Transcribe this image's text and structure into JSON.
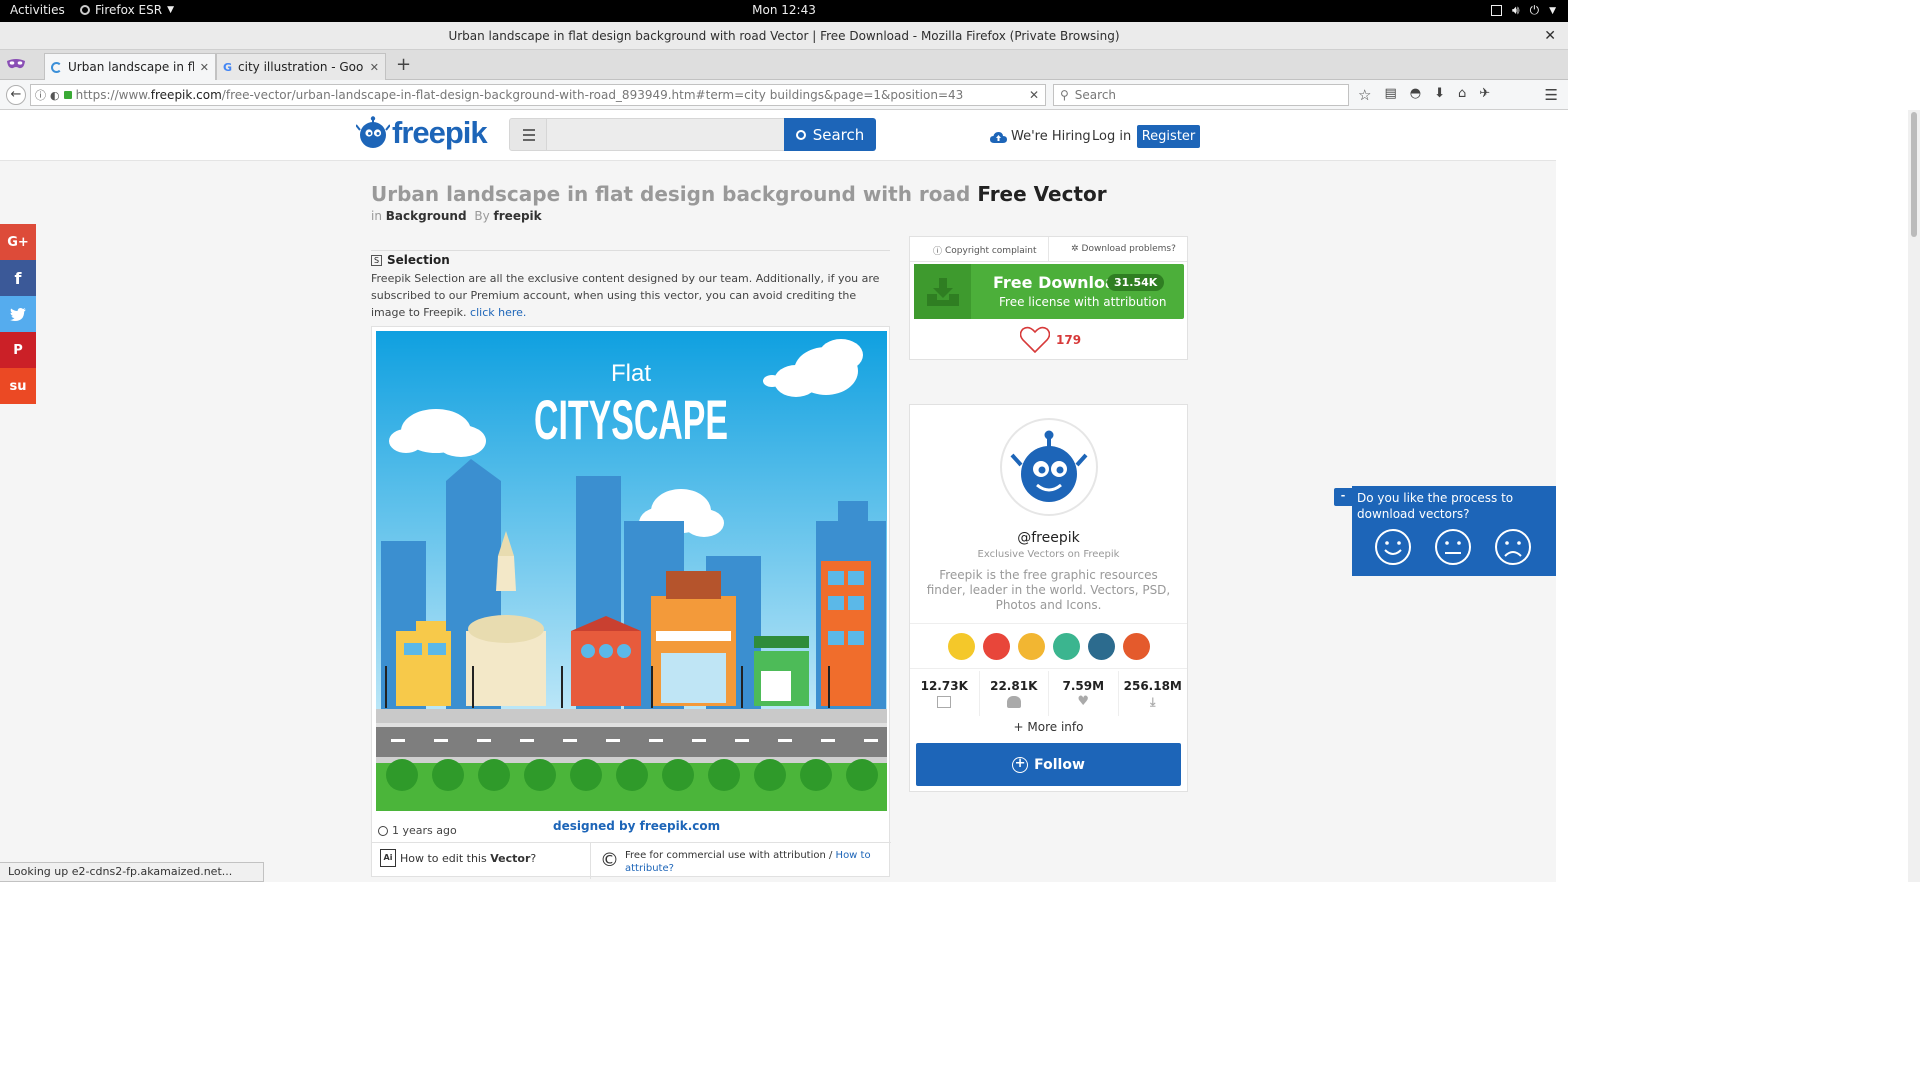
{
  "system_bar": {
    "activities": "Activities",
    "app_menu": "Firefox ESR",
    "clock": "Mon 12:43"
  },
  "window": {
    "title": "Urban landscape in flat design background with road Vector | Free Download - Mozilla Firefox (Private Browsing)",
    "close": "✕"
  },
  "tabs": [
    {
      "label": "Urban landscape in fla...",
      "active": true
    },
    {
      "label": "city illustration - Goog...",
      "active": false
    }
  ],
  "nav": {
    "url_prefix": "https://www.",
    "url_domain": "freepik.com",
    "url_rest": "/free-vector/urban-landscape-in-flat-design-background-with-road_893949.htm#term=city buildings&page=1&position=43",
    "search_placeholder": "Search"
  },
  "site": {
    "logo_text": "freepik",
    "search_button": "Search",
    "hiring": "We're Hiring",
    "login": "Log in",
    "register": "Register"
  },
  "social": [
    {
      "label": "G+",
      "color": "#dd4b39"
    },
    {
      "label": "f",
      "color": "#3b5998"
    },
    {
      "label": "t",
      "color": "#55acee"
    },
    {
      "label": "P",
      "color": "#cb2027"
    },
    {
      "label": "su",
      "color": "#eb4924"
    }
  ],
  "resource": {
    "title": "Urban landscape in flat design background with road",
    "title_suffix": "Free Vector",
    "in_label": "in",
    "category": "Background",
    "by_label": "By",
    "author": "freepik",
    "selection_heading": "Selection",
    "selection_text": "Freepik Selection are all the exclusive content designed by our team. Additionally, if you are subscribed to our Premium account, when using this vector, you can avoid crediting the image to Freepik.",
    "selection_link": "click here.",
    "image_title_small": "Flat",
    "image_title_big": "CITYSCAPE",
    "time_ago": "1 years ago",
    "designed_by": "designed by",
    "designed_brand": "freepik.com",
    "edit_prefix": "How to edit this",
    "edit_bold": "Vector",
    "edit_suffix": "?",
    "license_text": "Free for commercial use with attribution /",
    "license_link": "How to attribute?"
  },
  "download": {
    "copyright": "Copyright complaint",
    "problems": "Download problems?",
    "button_label": "Free Download",
    "count": "31.54K",
    "license": "Free license with attribution",
    "likes": "179"
  },
  "author_card": {
    "handle": "@freepik",
    "subtitle": "Exclusive Vectors on Freepik",
    "description": "Freepik is the free graphic resources finder, leader in the world. Vectors, PSD, Photos and Icons.",
    "badge_colors": [
      "#f4c82a",
      "#e8463a",
      "#f2b632",
      "#3bb58f",
      "#2c6b8e",
      "#e45a2c"
    ],
    "stats": [
      {
        "value": "12.73K",
        "icon": "image-icon"
      },
      {
        "value": "22.81K",
        "icon": "followers-icon"
      },
      {
        "value": "7.59M",
        "icon": "heart-icon"
      },
      {
        "value": "256.18M",
        "icon": "download-icon"
      }
    ],
    "more_info": "+ More info",
    "follow": "Follow"
  },
  "survey": {
    "question": "Do you like the process to download vectors?",
    "toggle": "-"
  },
  "status_bar": "Looking up e2-cdns2-fp.akamaized.net..."
}
